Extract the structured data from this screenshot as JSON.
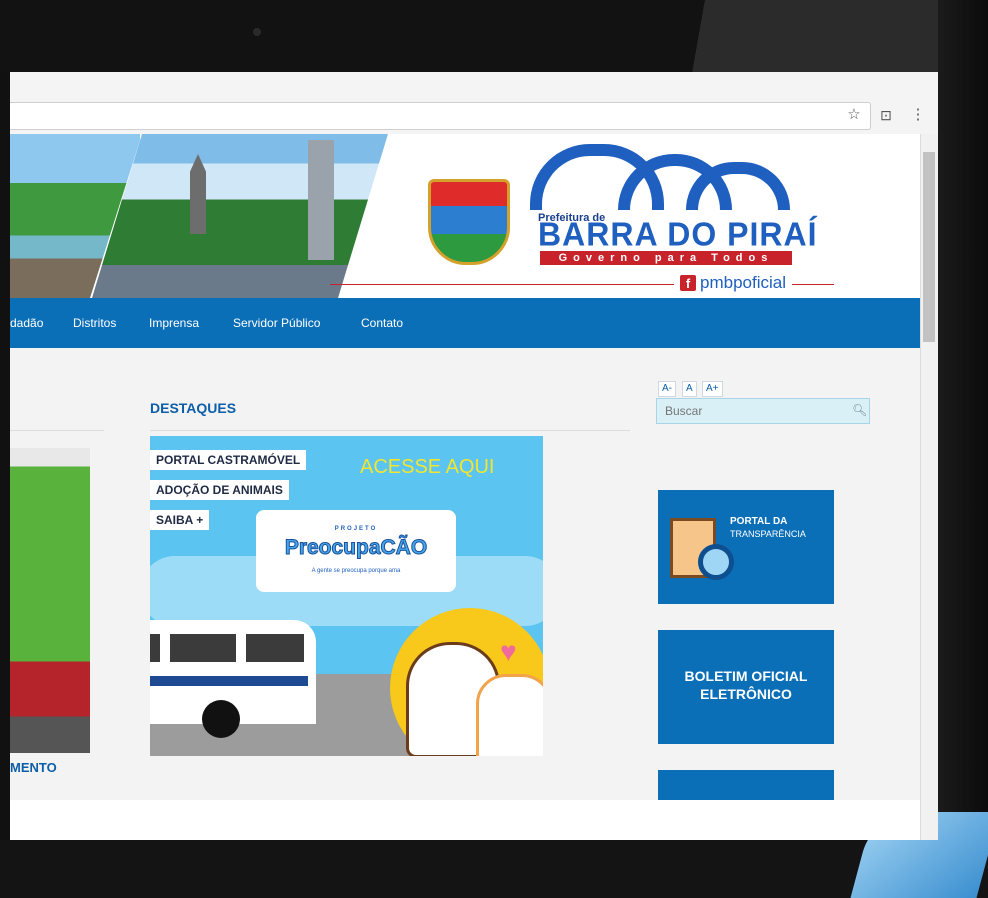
{
  "header": {
    "prefeitura_prefix": "Prefeitura de",
    "brand_name": "BARRA DO PIRAÍ",
    "slogan": "Governo para Todos",
    "social_handle": "pmbpoficial",
    "facebook_glyph": "f",
    "colors": {
      "brand_blue": "#1f5fbf",
      "brand_red": "#c8222b",
      "nav_blue": "#0b6fb8"
    }
  },
  "nav": {
    "items": [
      "dadão",
      "Distritos",
      "Imprensa",
      "Servidor Público",
      "Contato"
    ]
  },
  "left_column": {
    "label": "MENTO"
  },
  "destaques": {
    "heading": "DESTAQUES",
    "banner": {
      "tags": [
        "PORTAL CASTRAMÓVEL",
        "ADOÇÃO DE ANIMAIS",
        "SAIBA +"
      ],
      "cta": "ACESSE AQUI",
      "project_label": "PROJETO",
      "project_title": "PreocupaCÃO",
      "project_tagline": "A gente se preocupa porque ama"
    }
  },
  "sidebar": {
    "font_controls": [
      "A-",
      "A",
      "A+"
    ],
    "search": {
      "placeholder": "Buscar",
      "icon": "search-icon"
    },
    "portal": {
      "title": "PORTAL DA",
      "subtitle": "TRANSPARÊNCIA"
    },
    "boletim": {
      "line1": "BOLETIM OFICIAL",
      "line2": "ELETRÔNICO"
    }
  },
  "browser": {
    "icons": [
      "star-icon",
      "extension-icon",
      "menu-icon"
    ]
  }
}
